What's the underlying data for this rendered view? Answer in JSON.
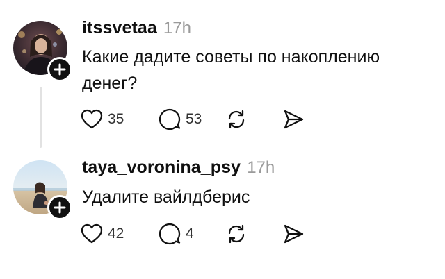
{
  "posts": [
    {
      "username": "itssvetaa",
      "time": "17h",
      "text": "Какие дадите советы по накоплению денег?",
      "likes": "35",
      "replies": "53"
    },
    {
      "username": "taya_voronina_psy",
      "time": "17h",
      "text": "Удалите вайлдберис",
      "likes": "42",
      "replies": "4"
    }
  ],
  "icons": {
    "like": "heart-icon",
    "reply": "comment-icon",
    "repost": "repost-icon",
    "share": "send-icon",
    "follow": "plus-icon"
  },
  "colors": {
    "text": "#101010",
    "secondary": "#9a9a9a",
    "badge": "#111111",
    "thread_line": "#e2e2e2"
  }
}
